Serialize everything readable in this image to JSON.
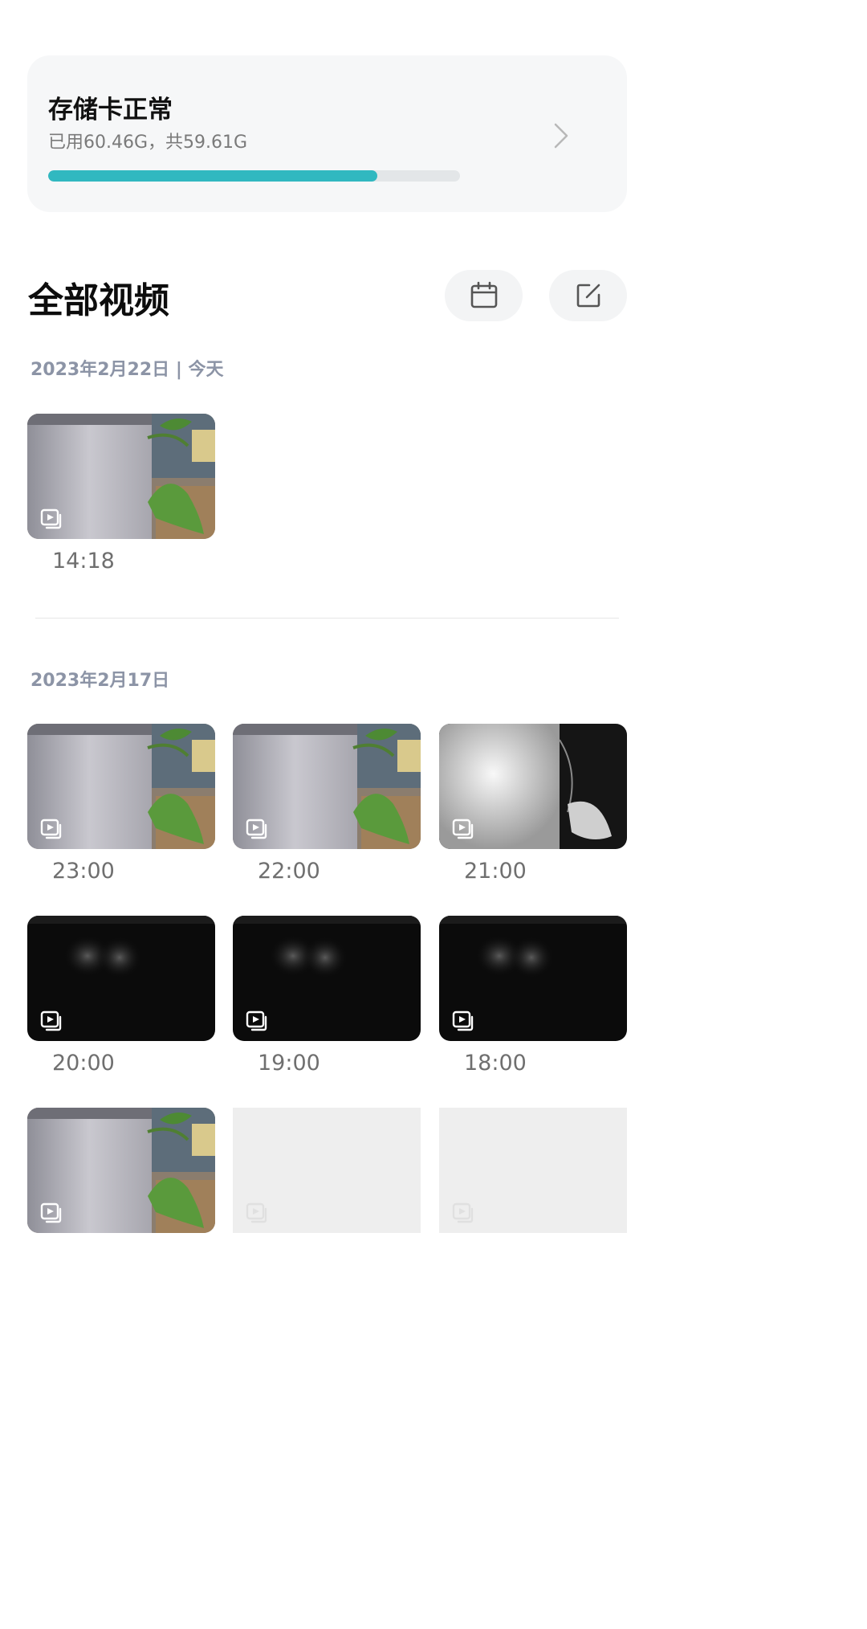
{
  "storage": {
    "title": "存储卡正常",
    "usage": "已用60.46G，共59.61G",
    "progress_fraction": 0.8,
    "bar_color": "#31b8c0"
  },
  "section": {
    "title": "全部视频",
    "calendar_icon": "calendar-icon",
    "edit_icon": "edit-icon"
  },
  "groups": [
    {
      "date": "2023年2月22日 | 今天",
      "videos": [
        {
          "time": "14:18",
          "scene": "day"
        }
      ]
    },
    {
      "date": "2023年2月17日",
      "videos": [
        {
          "time": "23:00",
          "scene": "day"
        },
        {
          "time": "22:00",
          "scene": "day"
        },
        {
          "time": "21:00",
          "scene": "night-ir"
        },
        {
          "time": "20:00",
          "scene": "dark"
        },
        {
          "time": "19:00",
          "scene": "dark"
        },
        {
          "time": "18:00",
          "scene": "dark"
        },
        {
          "time": "",
          "scene": "day"
        },
        {
          "time": "",
          "scene": "placeholder"
        },
        {
          "time": "",
          "scene": "placeholder"
        }
      ]
    }
  ],
  "colors": {
    "date_label": "#8c94a6",
    "time_label": "#6f6f6f",
    "card_bg": "#f6f7f8"
  }
}
